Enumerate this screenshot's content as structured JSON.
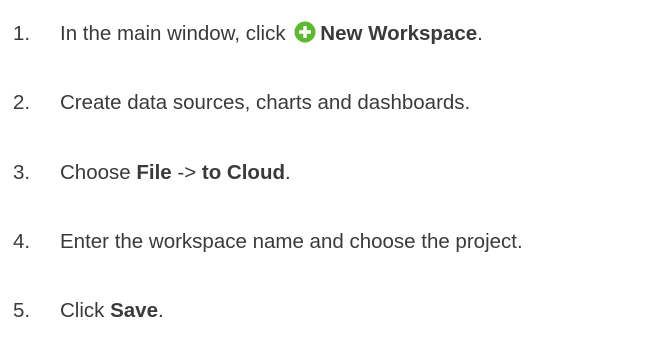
{
  "steps": [
    {
      "number": "1.",
      "before": "In the main window, click ",
      "icon": "add-circle-icon",
      "bold": "New Workspace",
      "after": "."
    },
    {
      "number": "2.",
      "text": "Create data sources, charts and dashboards."
    },
    {
      "number": "3.",
      "before": "Choose ",
      "bold1": "File",
      "arrow": " -> ",
      "bold2": "to Cloud",
      "after": "."
    },
    {
      "number": "4.",
      "text": "Enter the workspace name and choose the project."
    },
    {
      "number": "5.",
      "before": "Click ",
      "bold": "Save",
      "after": "."
    }
  ],
  "colors": {
    "text": "#3a3a3a",
    "icon_green": "#5cb82f"
  }
}
